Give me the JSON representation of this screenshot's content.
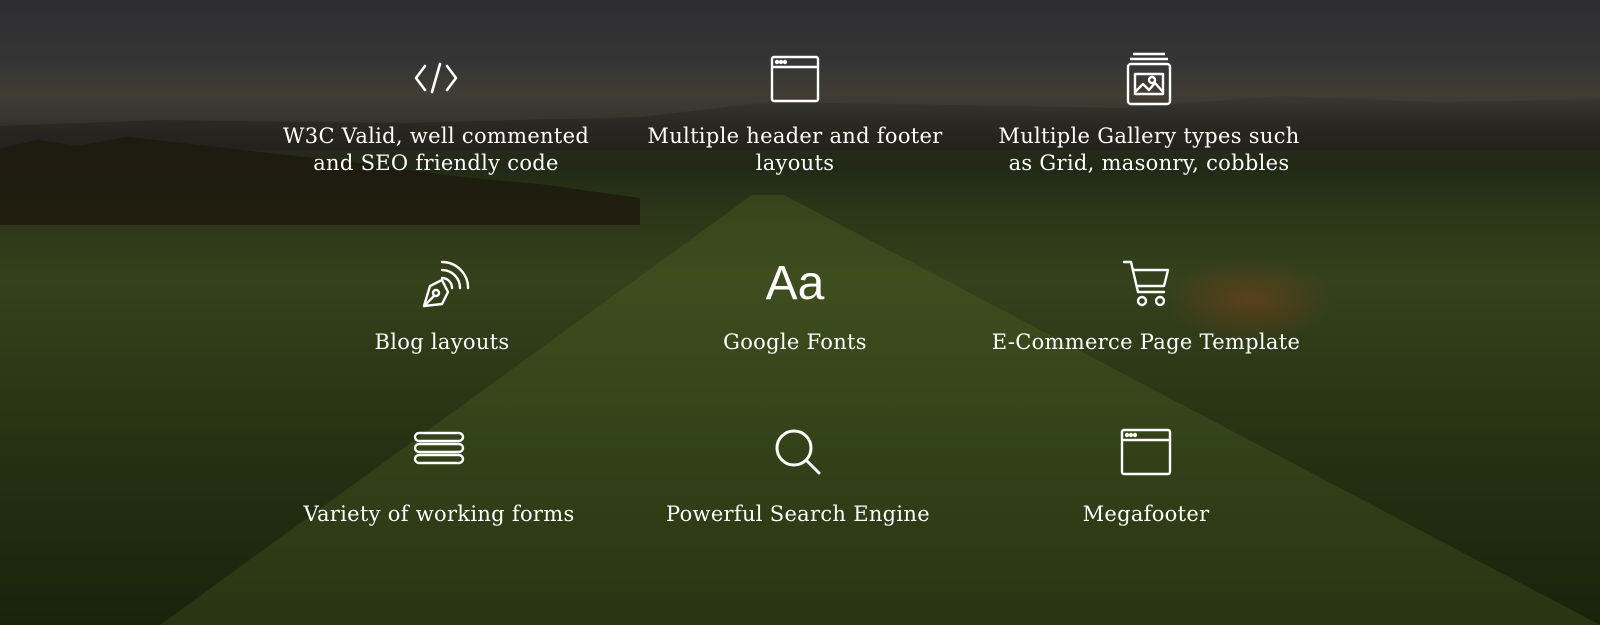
{
  "features": [
    {
      "icon": "code-icon",
      "label": "W3C Valid, well commented and SEO friendly code"
    },
    {
      "icon": "browser-window-icon",
      "label": "Multiple header and footer layouts"
    },
    {
      "icon": "gallery-icon",
      "label": "Multiple Gallery types such as Grid, masonry, cobbles"
    },
    {
      "icon": "pen-nib-icon",
      "label": "Blog layouts"
    },
    {
      "icon": "font-icon",
      "glyph": "Aa",
      "label": "Google Fonts"
    },
    {
      "icon": "shopping-cart-icon",
      "label": "E-Commerce Page Template"
    },
    {
      "icon": "form-lines-icon",
      "label": "Variety of working forms"
    },
    {
      "icon": "search-icon",
      "label": "Powerful Search Engine"
    },
    {
      "icon": "browser-window-icon",
      "label": "Megafooter"
    }
  ],
  "colors": {
    "text": "#ffffff",
    "icon": "#ffffff"
  }
}
